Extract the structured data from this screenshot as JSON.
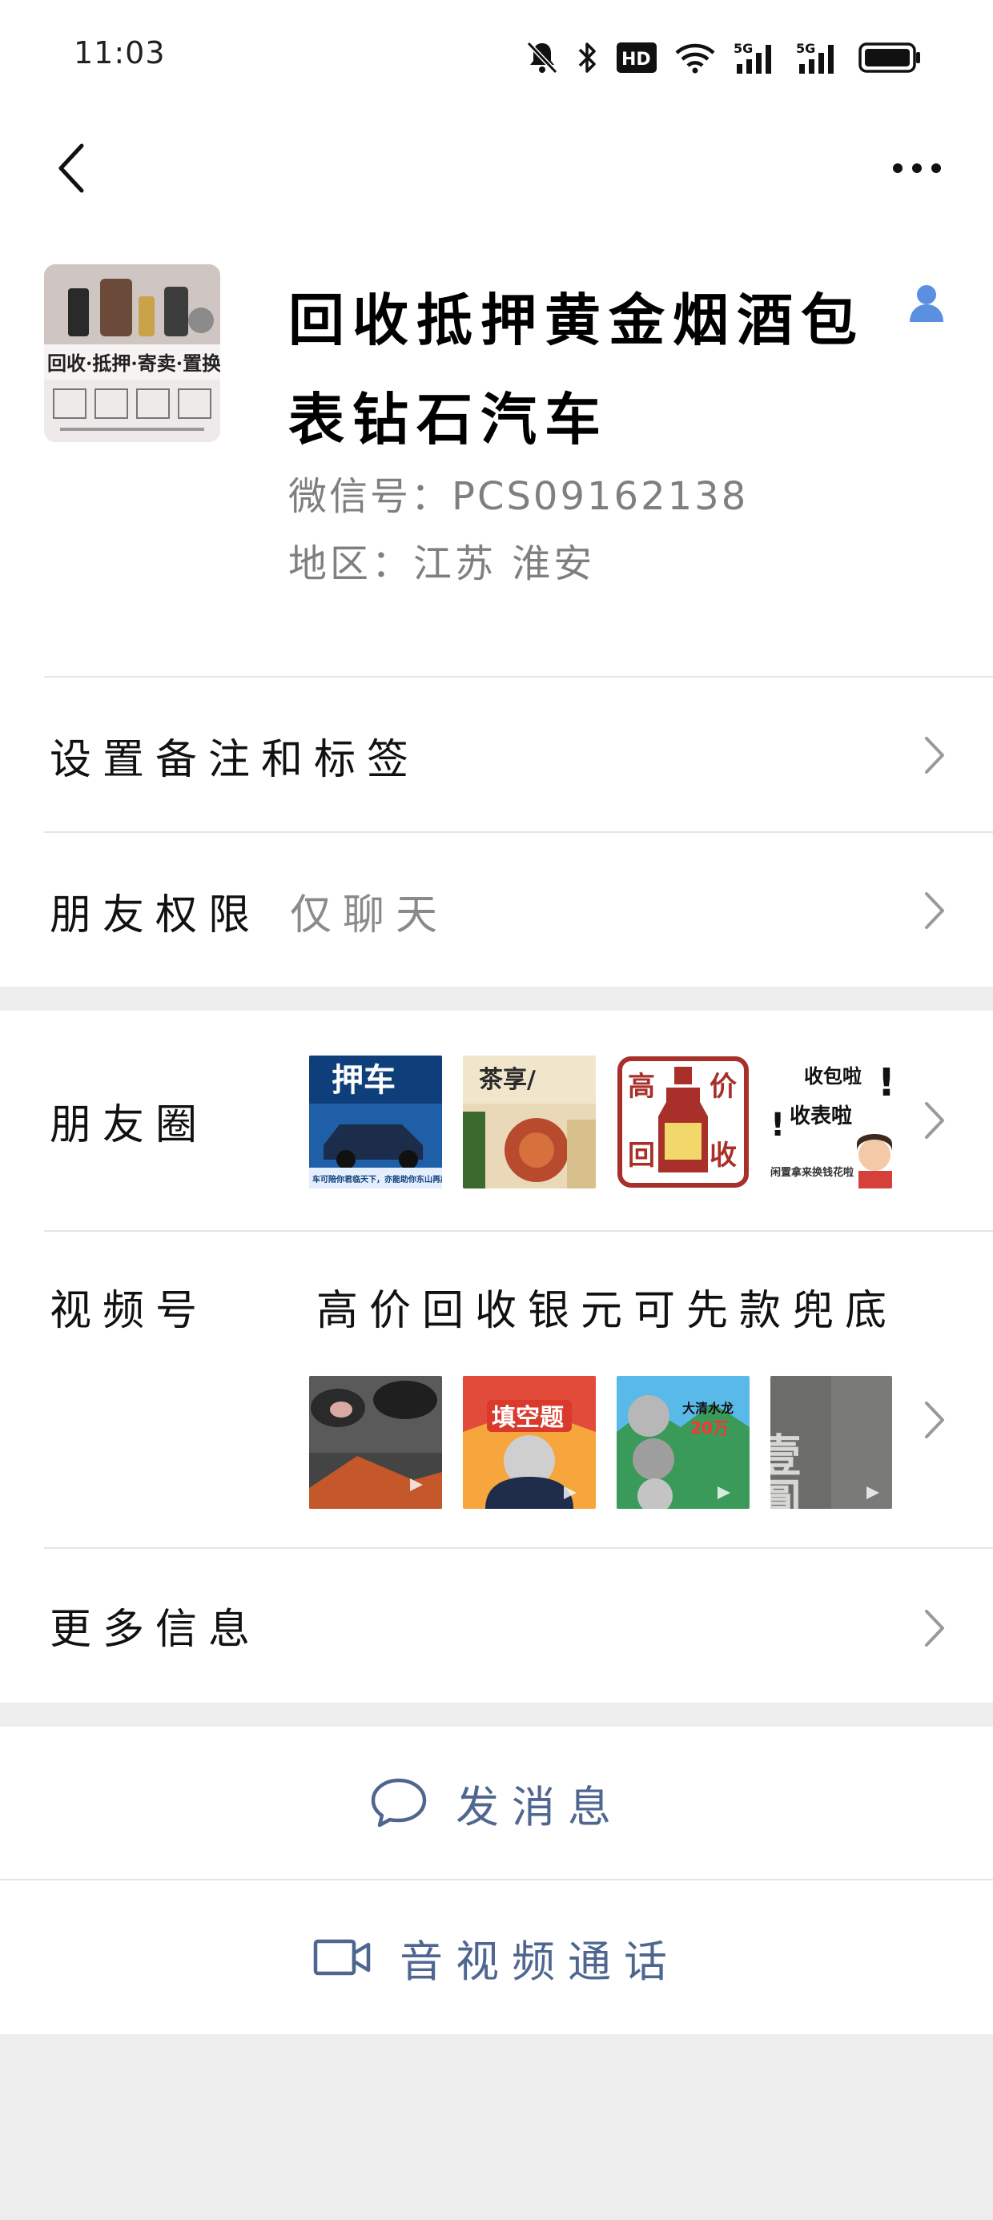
{
  "status_bar": {
    "time": "11:03",
    "icons": [
      "mute-bell-icon",
      "bluetooth-icon",
      "hd-icon",
      "wifi-icon",
      "5g-signal-icon",
      "5g-signal-icon",
      "battery-icon"
    ]
  },
  "nav": {
    "back_icon": "chevron-left-icon",
    "more_icon": "more-dots-icon"
  },
  "profile": {
    "name": "回收抵押黄金烟酒包表钻石汽车",
    "wechat_id": "微信号：PCS09162138",
    "region": "地区：江苏  淮安",
    "avatar_text": "回收·抵押·寄卖·置换"
  },
  "rows": {
    "remark": {
      "label": "设置备注和标签"
    },
    "permission": {
      "label": "朋友权限",
      "value": "仅聊天"
    },
    "moments": {
      "label": "朋友圈"
    },
    "channels": {
      "label": "视频号",
      "title": "高价回收银元可先款兜底"
    },
    "more_info": {
      "label": "更多信息"
    }
  },
  "moments_thumbs": {
    "t1": {
      "title": "押车",
      "caption": "车可陪你君临天下，亦能助你东山再起！"
    },
    "t2": {
      "title": "茶享/"
    },
    "t3": {
      "tl": "高",
      "tr": "价",
      "bl": "回",
      "br": "收"
    },
    "t4": {
      "line1": "收包啦",
      "line2": "收表啦",
      "line3": "闲置拿来换钱花啦"
    }
  },
  "channel_thumbs": {
    "t2": {
      "title": "填空题"
    },
    "t3": {
      "line1": "大清水龙",
      "line2": "20万"
    },
    "t4": {
      "chars": "壹圓"
    }
  },
  "actions": {
    "message": {
      "label": "发消息"
    },
    "call": {
      "label": "音视频通话"
    }
  },
  "colors": {
    "link_blue": "#4e6690",
    "gray_text": "#7f7f7f",
    "divider": "#e5e5e5",
    "background": "#ededed"
  }
}
